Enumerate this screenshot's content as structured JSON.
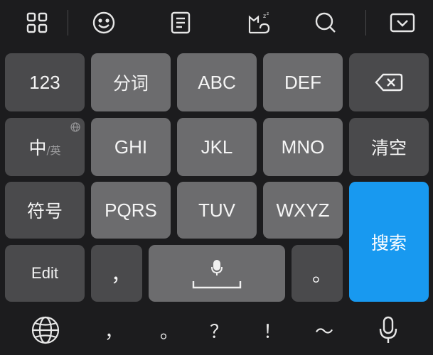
{
  "toolbar": {
    "icons": [
      "apps-grid-icon",
      "emoji-icon",
      "clipboard-icon",
      "cat-sleep-icon",
      "search-icon",
      "collapse-keyboard-icon"
    ]
  },
  "keys": {
    "numbers": "123",
    "segment": "分词",
    "abc": "ABC",
    "def": "DEF",
    "lang_main": "中",
    "lang_alt": "/英",
    "ghi": "GHI",
    "jkl": "JKL",
    "mno": "MNO",
    "clear": "清空",
    "symbols": "符号",
    "pqrs": "PQRS",
    "tuv": "TUV",
    "wxyz": "WXYZ",
    "search": "搜索",
    "edit": "Edit",
    "comma": "，",
    "period": "。"
  },
  "bottom_bar": {
    "comma": "，",
    "period": "。",
    "question": "？",
    "exclaim": "！",
    "tilde": "～"
  },
  "colors": {
    "background": "#1c1c1e",
    "key_dark": "#4a4a4c",
    "key_light": "#6c6c6e",
    "accent": "#1899f0"
  }
}
